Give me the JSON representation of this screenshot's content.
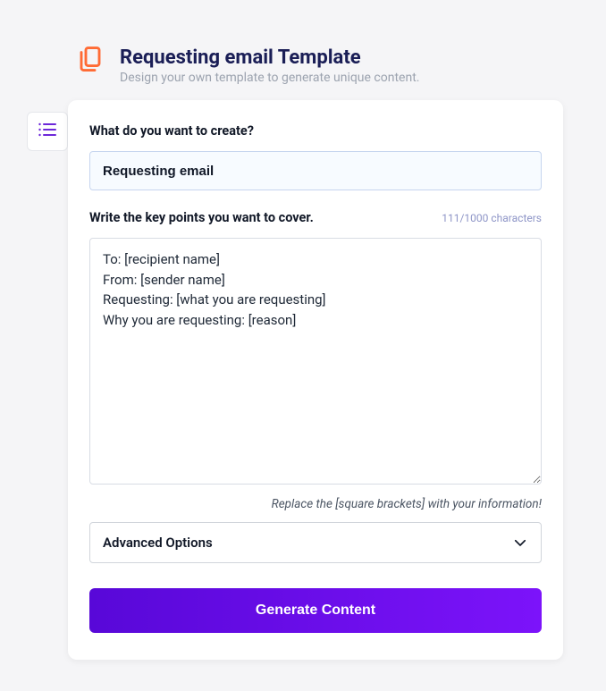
{
  "header": {
    "title": "Requesting email Template",
    "subtitle": "Design your own template to generate unique content."
  },
  "form": {
    "create_label": "What do you want to create?",
    "create_value": "Requesting email",
    "keypoints_label": "Write the key points you want to cover.",
    "keypoints_char_counter": "111/1000 characters",
    "keypoints_value": "To: [recipient name]\nFrom: [sender name]\nRequesting: [what you are requesting]\nWhy you are requesting: [reason]",
    "keypoints_helper": "Replace the [square brackets] with your information!",
    "advanced_label": "Advanced Options",
    "generate_label": "Generate Content"
  },
  "icons": {
    "header_color": "#ff6b35",
    "side_color": "#6d28d9"
  }
}
